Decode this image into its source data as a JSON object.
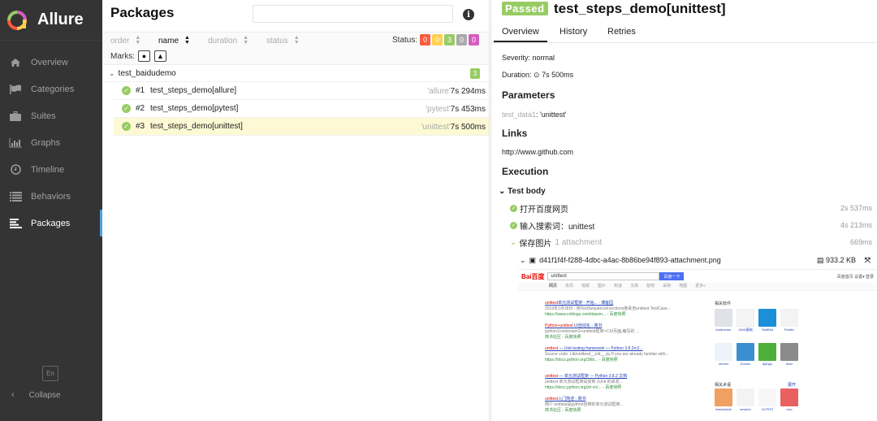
{
  "app": {
    "name": "Allure"
  },
  "sidebar": {
    "items": [
      {
        "label": "Overview",
        "icon": "home-icon"
      },
      {
        "label": "Categories",
        "icon": "flag-icon"
      },
      {
        "label": "Suites",
        "icon": "briefcase-icon"
      },
      {
        "label": "Graphs",
        "icon": "bar-chart-icon"
      },
      {
        "label": "Timeline",
        "icon": "clock-icon"
      },
      {
        "label": "Behaviors",
        "icon": "list-icon"
      },
      {
        "label": "Packages",
        "icon": "align-left-icon",
        "active": true
      }
    ],
    "language": "En",
    "collapse_label": "Collapse"
  },
  "packages": {
    "title": "Packages",
    "search_placeholder": "",
    "sort": [
      {
        "label": "order"
      },
      {
        "label": "name",
        "active": true
      },
      {
        "label": "duration"
      },
      {
        "label": "status"
      }
    ],
    "status_label": "Status:",
    "status_counts": [
      {
        "name": "failed",
        "value": "0",
        "color": "#fd5a3e"
      },
      {
        "name": "broken",
        "value": "0",
        "color": "#ffd050"
      },
      {
        "name": "passed",
        "value": "3",
        "color": "#97cc64"
      },
      {
        "name": "skipped",
        "value": "0",
        "color": "#aaaaaa"
      },
      {
        "name": "unknown",
        "value": "0",
        "color": "#d35ebe"
      }
    ],
    "marks_label": "Marks:",
    "group": {
      "name": "test_baidudemo",
      "count": "3"
    },
    "tests": [
      {
        "num": "#1",
        "name": "test_steps_demo[allure]",
        "param": "'allure'",
        "duration": "7s 294ms"
      },
      {
        "num": "#2",
        "name": "test_steps_demo[pytest]",
        "param": "'pytest'",
        "duration": "7s 453ms"
      },
      {
        "num": "#3",
        "name": "test_steps_demo[unittest]",
        "param": "'unittest'",
        "duration": "7s 500ms",
        "selected": true
      }
    ]
  },
  "detail": {
    "status": "Passed",
    "title": "test_steps_demo[unittest]",
    "tabs": [
      "Overview",
      "History",
      "Retries"
    ],
    "severity": "Severity: normal",
    "duration_label": "Duration:",
    "duration": "7s 500ms",
    "parameters_heading": "Parameters",
    "param_name": "test_data1",
    "param_value": ": 'unittest'",
    "links_heading": "Links",
    "link": "http://www.github.com",
    "execution_heading": "Execution",
    "test_body_label": "Test body",
    "steps": [
      {
        "name": "打开百度网页",
        "time": "2s 537ms"
      },
      {
        "name": "输入搜索词：unittest",
        "time": "4s 213ms"
      },
      {
        "name": "保存图片",
        "extra": "1 attachment",
        "time": "669ms"
      }
    ],
    "attachment": {
      "name": "d41f1f4f-f288-4dbc-a4ac-8b86be94f893-attachment.png",
      "size": "933.2 KB"
    }
  },
  "screenshot_preview": {
    "logo": "Bai百度",
    "query": "unittest",
    "search_button": "百度一下",
    "top_links": "百度首页  设置▾  登录",
    "nav": [
      "网页",
      "资讯",
      "视频",
      "图片",
      "知道",
      "文库",
      "贴吧",
      "采购",
      "地图",
      "更多»"
    ],
    "results": [
      {
        "title_red": "unittest",
        "title": "单元测试框架 - 开始... - 博客园",
        "desc": "2019年2月28日 - 用TestSequenceFunctions继承自unittest.TestCase...",
        "url": "https://www.cnblogs.com/dawxn... - 百度快照"
      },
      {
        "title_red": "Python+unittest",
        "title": " UI自动化 - 简书",
        "desc": "python3+selenium3+unittest框架+C对页面,编写的 ...",
        "url": "简书社区 - 百度快照"
      },
      {
        "title_red": "unittest",
        "title": " — Unit testing framework — Python 3.8.2rc2...",
        "desc": "Source code: Lib/unittest/__init__.py If you are already familiar with...",
        "url": "https://docs.python.org/3/lib... - 百度快照"
      },
      {
        "title_red": "unittest",
        "title": " — 单元测试框架 — Python 3.8.2 文档",
        "desc": "unittest 单元测试框架是受到 JUnit 的启发...",
        "url": "https://docs.python.org/zh-cn/... - 百度快照"
      },
      {
        "title_red": "unittest",
        "title": "入门简述 - 简书",
        "desc": "简介 unittest是python自带的单元测试框架...",
        "url": "简书社区 - 百度快照"
      }
    ],
    "side_heading": "相关软件",
    "side_items": [
      "loadrunner",
      "JAVA基础",
      "TestBird",
      "Fiddler",
      "servlet",
      "Docker",
      "django",
      "linux"
    ],
    "side_heading2": "相关术语",
    "side_more": "展开",
    "side_items2": [
      "testmodule",
      "session",
      "JUTEST",
      "mvc"
    ]
  }
}
